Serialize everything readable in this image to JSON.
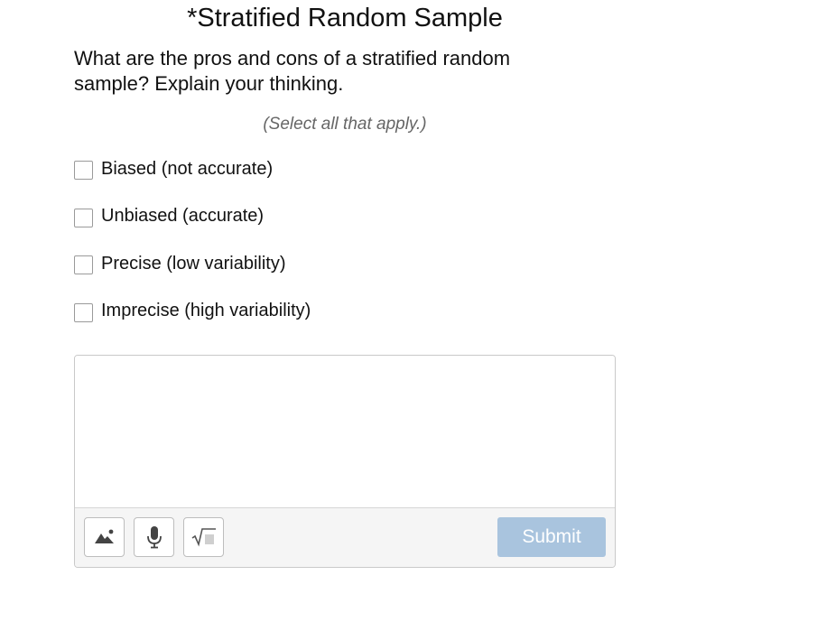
{
  "question": {
    "title": "*Stratified Random Sample",
    "prompt": "What are the pros and cons of a stratified random sample? Explain your thinking.",
    "hint": "(Select all that apply.)"
  },
  "options": [
    {
      "label": "Biased (not accurate)",
      "checked": false
    },
    {
      "label": "Unbiased (accurate)",
      "checked": false
    },
    {
      "label": "Precise (low variability)",
      "checked": false
    },
    {
      "label": "Imprecise (high variability)",
      "checked": false
    }
  ],
  "answer": {
    "value": "",
    "toolbar": {
      "image_icon": "image-icon",
      "mic_icon": "microphone-icon",
      "math_icon": "square-root-icon",
      "submit_label": "Submit",
      "submit_color": "#a9c4de"
    }
  }
}
